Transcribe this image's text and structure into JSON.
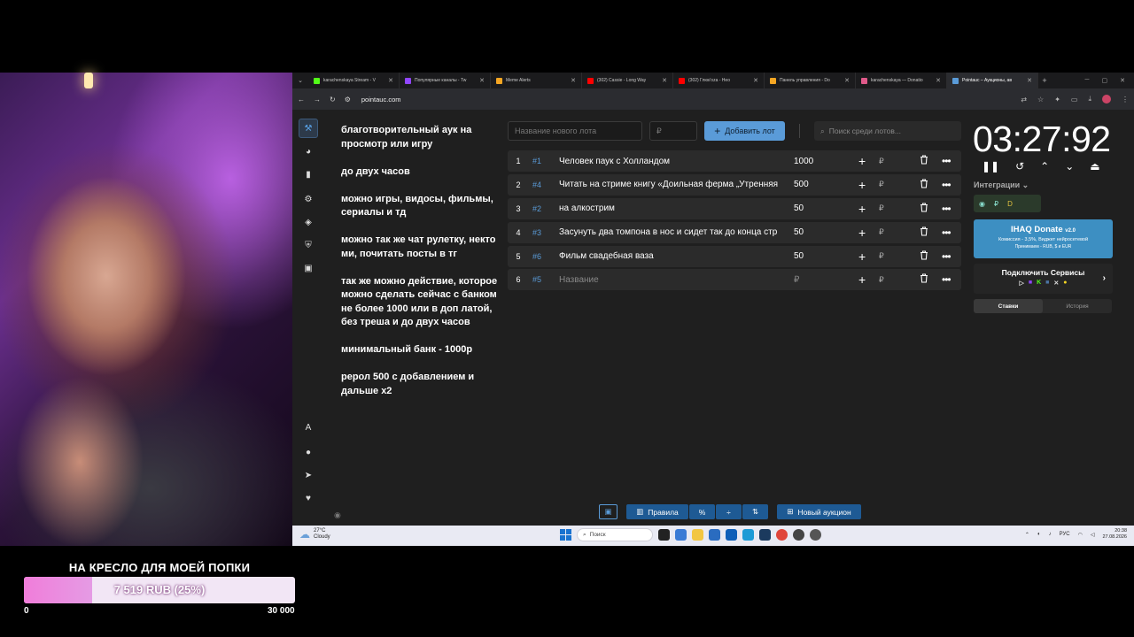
{
  "goal": {
    "title": "НА КРЕСЛО ДЛЯ МОЕЙ ПОПКИ",
    "progress_text": "7 519 RUB (25%)",
    "progress_fraction": 0.25,
    "min": "0",
    "max": "30 000"
  },
  "browser": {
    "tabs": [
      {
        "label": "karachenskaya Stream - V",
        "color": "#53fc18"
      },
      {
        "label": "Популярные каналы - Tw",
        "color": "#9146ff"
      },
      {
        "label": "Meme Alerts",
        "color": "#f5a623"
      },
      {
        "label": "(302) Cassie - Long Way",
        "color": "#ff0000"
      },
      {
        "label": "(302) Глюк'oza - Нео",
        "color": "#ff0000"
      },
      {
        "label": "Панель управления - Do",
        "color": "#f5a623"
      },
      {
        "label": "karachenskaya — Donatio",
        "color": "#e05a8a"
      },
      {
        "label": "Pointauc – Аукционы, ав",
        "color": "#5a9bd8"
      }
    ],
    "url": "pointauc.com"
  },
  "rules_text": "благотворительный аук на просмотр или игру\n\nдо  двух часов\n\nможно игры, видосы, фильмы, сериалы и тд\n\nможно так же чат рулетку, некто ми, почитать посты в тг\n\nтак же можно действие, которое можно сделать сейчас с банком не более 1000 или в доп латой, без треша  и до двух часов\n\nминимальный банк - 1000р\n\nрерол 500 с добавлением и дальше х2",
  "controls": {
    "lot_name_placeholder": "Название нового лота",
    "price_placeholder": "₽",
    "add_lot_label": "Добавить лот",
    "search_placeholder": "Поиск среди лотов..."
  },
  "lots": [
    {
      "n": "1",
      "id": "#1",
      "name": "Человек паук с Холландом",
      "amount": "1000"
    },
    {
      "n": "2",
      "id": "#4",
      "name": "Читать на стриме книгу «Доильная ферма „Утренняя",
      "amount": "500"
    },
    {
      "n": "3",
      "id": "#2",
      "name": "на алкострим",
      "amount": "50"
    },
    {
      "n": "4",
      "id": "#3",
      "name": "Засунуть два томпона в нос и сидет так до конца стр",
      "amount": "50"
    },
    {
      "n": "5",
      "id": "#6",
      "name": "Фильм свадебная ваза",
      "amount": "50"
    },
    {
      "n": "6",
      "id": "#5",
      "name": "Название",
      "amount": "₽"
    }
  ],
  "lot_currency": "₽",
  "timer": "03:27:92",
  "integrations_label": "Интеграции",
  "donate_banner": {
    "title": "IHAQ Donate",
    "version": "v2.0",
    "subtitle": "Комиссия - 3,5%, Виджет нейросетевой",
    "accepts": "Принимаем - RUB, $ и EUR"
  },
  "connect_services": "Подключить Сервисы",
  "tabs_bets": {
    "bets": "Ставки",
    "history": "История"
  },
  "bottom": {
    "rules": "Правила",
    "percent": "%",
    "divide": "÷",
    "sort": "⇅",
    "new_auction": "Новый аукцион"
  },
  "taskbar": {
    "temp": "27°C",
    "weather": "Cloudy",
    "search": "Поиск",
    "lang": "РУС",
    "time": "20:38",
    "date": "27.08.2026"
  },
  "colors": {
    "accent": "#5a9bd8",
    "app_bg": "#1f1f1f",
    "row_bg": "#2b2b2b"
  }
}
